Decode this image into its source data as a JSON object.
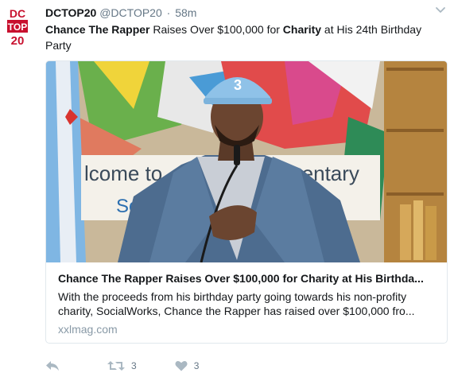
{
  "colors": {
    "brand_red": "#c8102e",
    "text": "#14171a",
    "muted": "#657786",
    "link_gray": "#8899a6",
    "border": "#e1e8ed"
  },
  "avatar": {
    "alt": "DCTOP20",
    "line1": "DC",
    "line2": "TOP",
    "line3": "20"
  },
  "tweet": {
    "name": "DCTOP20",
    "handle": "@DCTOP20",
    "separator": "·",
    "time": "58m",
    "text_bold1": "Chance The Rapper",
    "text_mid1": " Raises Over $100,000 for ",
    "text_bold2": "Charity",
    "text_mid2": " at His 24th Birthday Party"
  },
  "card": {
    "image_sign_left": "lcome to",
    "image_sign_right": "mentary",
    "image_sign_bottom": "Sc",
    "cap_number": "3",
    "title": "Chance The Rapper Raises Over $100,000 for Charity at His Birthda...",
    "description": "With the proceeds from his birthday party going towards his non-profity charity, SocialWorks, Chance the Rapper has raised over $100,000 fro...",
    "domain": "xxlmag.com"
  },
  "actions": {
    "reply_icon": "reply-icon",
    "retweet_icon": "retweet-icon",
    "retweet_count": "3",
    "like_icon": "heart-icon",
    "like_count": "3"
  }
}
